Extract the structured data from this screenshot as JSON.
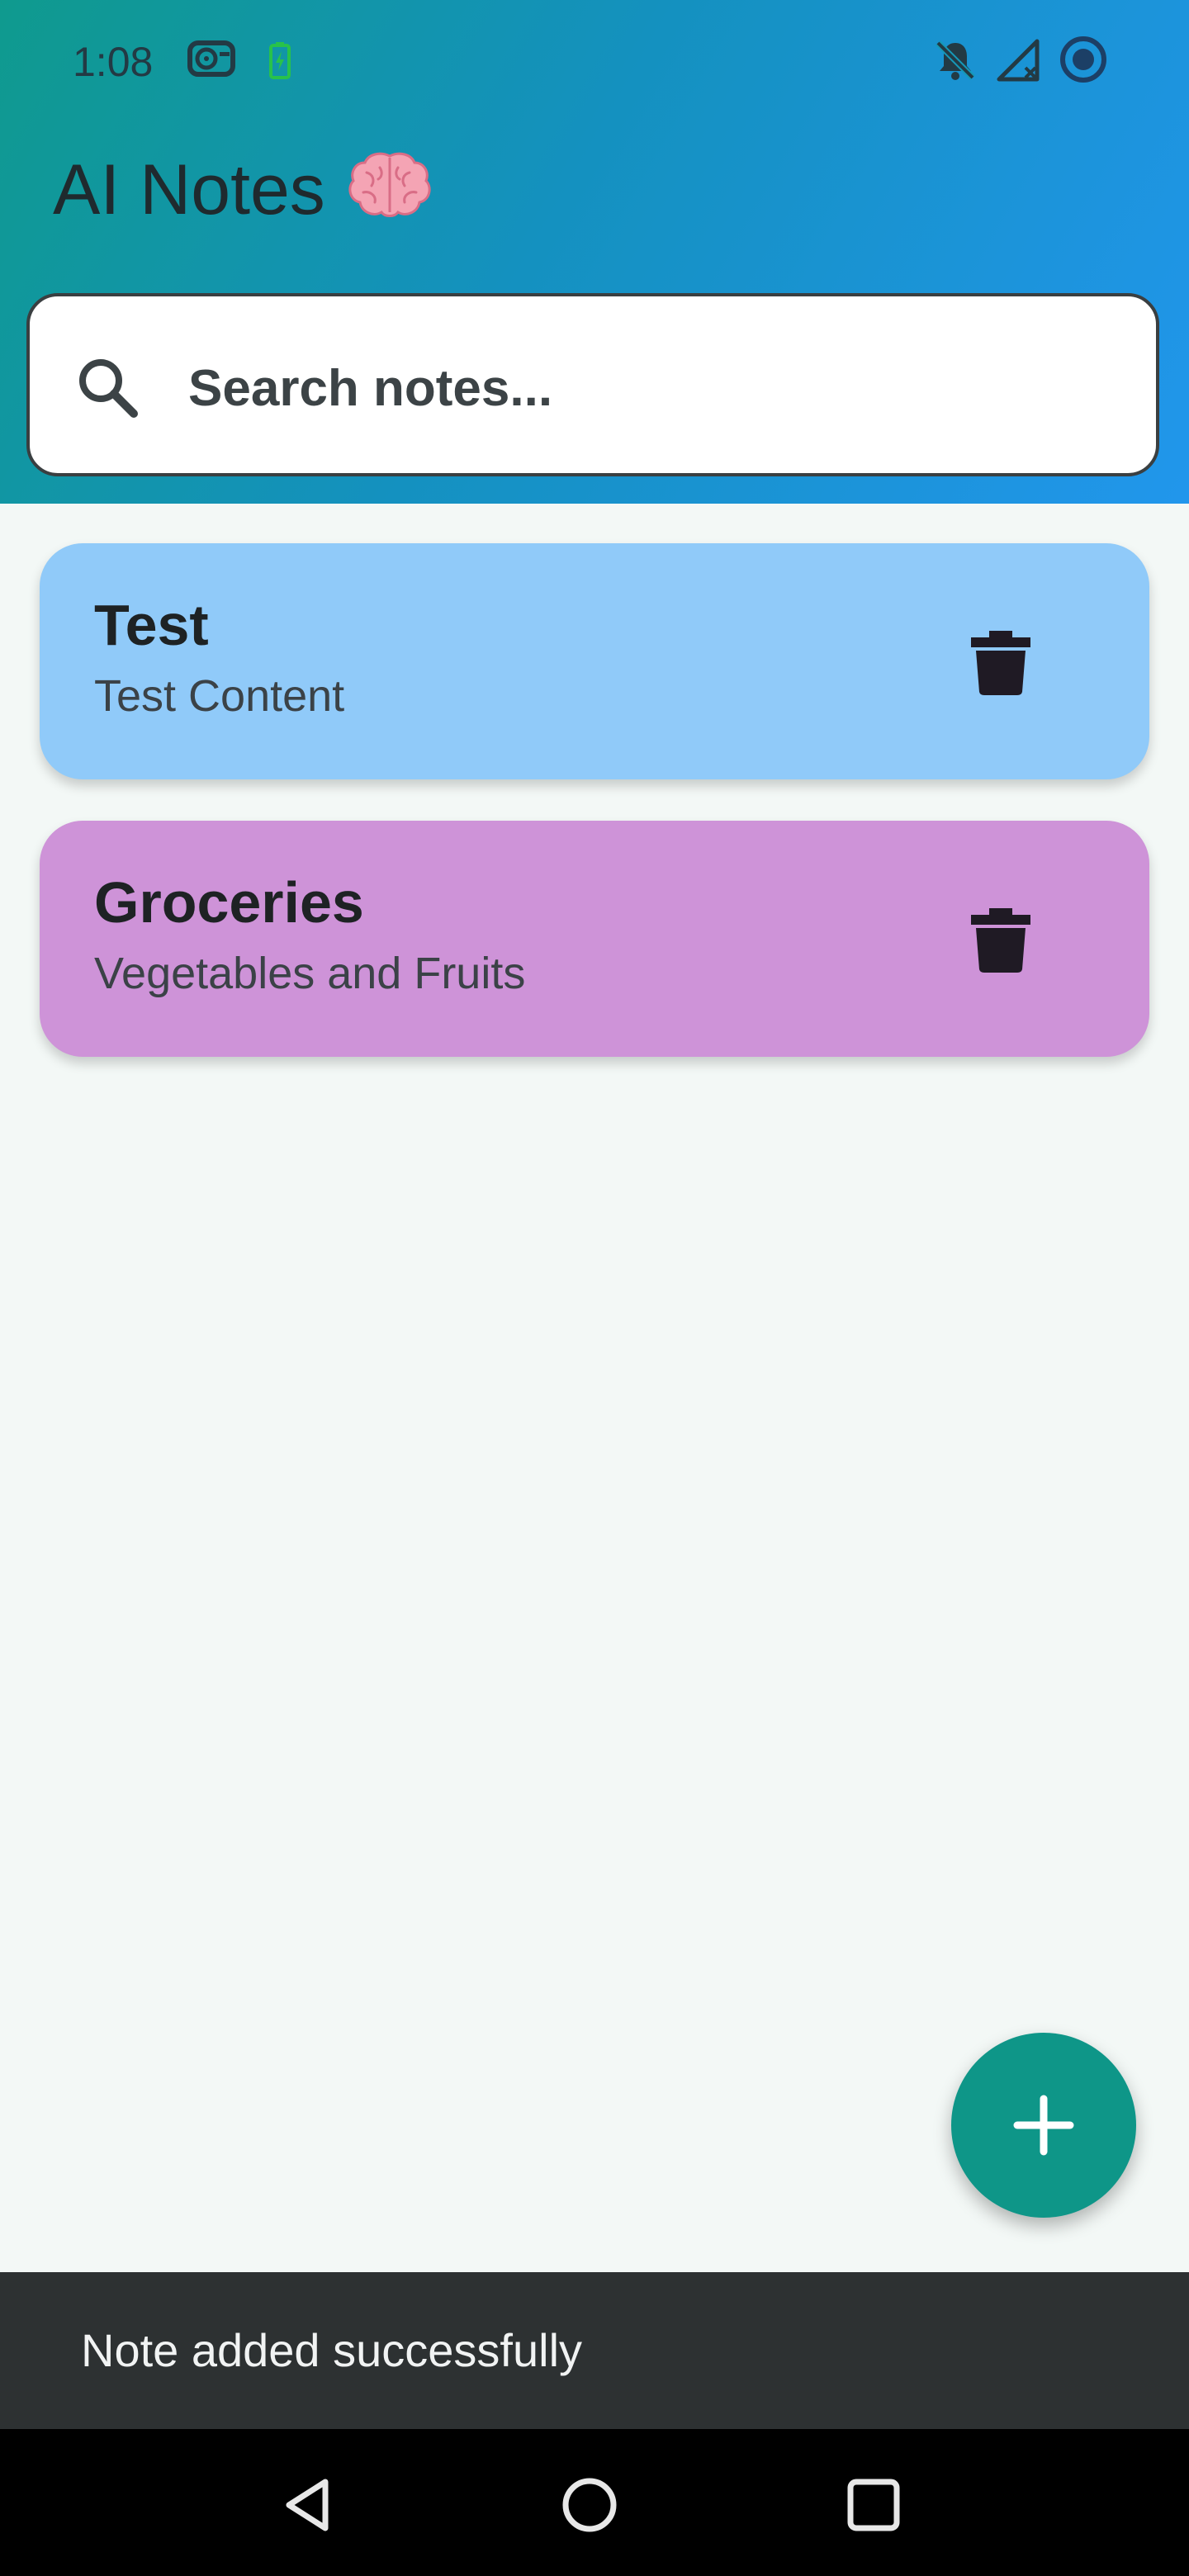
{
  "status_bar": {
    "time": "1:08",
    "icons": [
      "fan-icon",
      "battery-charging-icon",
      "notifications-off-icon",
      "no-signal-icon",
      "record-icon"
    ]
  },
  "app": {
    "title": "AI Notes",
    "title_emoji_icon": "brain-icon"
  },
  "search": {
    "placeholder": "Search notes...",
    "value": ""
  },
  "notes": [
    {
      "title": "Test",
      "content": "Test Content",
      "color": "#90caf9"
    },
    {
      "title": "Groceries",
      "content": "Vegetables and Fruits",
      "color": "#ce93d8"
    }
  ],
  "fab": {
    "icon": "plus-icon",
    "color": "#0e9688"
  },
  "snackbar": {
    "message": "Note added successfully"
  },
  "navigation": {
    "buttons": [
      "back-icon",
      "home-icon",
      "recents-icon"
    ]
  }
}
